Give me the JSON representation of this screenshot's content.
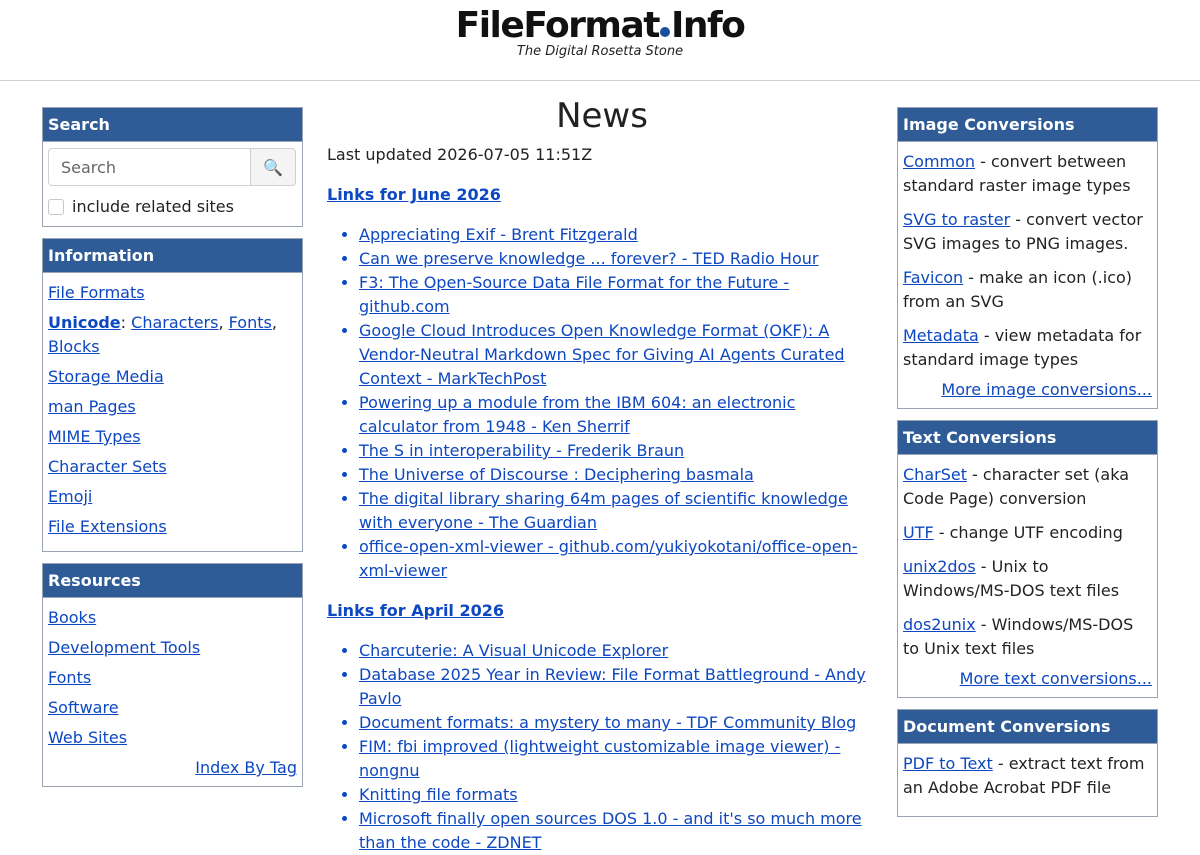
{
  "header": {
    "logo_part1": "FileFormat",
    "logo_part2": "Info",
    "tagline": "The Digital Rosetta Stone"
  },
  "search": {
    "title": "Search",
    "placeholder": "Search",
    "button_icon": "search-icon",
    "related_label": "include related sites"
  },
  "information": {
    "title": "Information",
    "file_formats": "File Formats",
    "unicode": "Unicode",
    "unicode_sep": ":",
    "characters": "Characters",
    "fonts": "Fonts",
    "blocks": "Blocks",
    "storage_media": "Storage Media",
    "man_pages": "man Pages",
    "mime_types": "MIME Types",
    "character_sets": "Character Sets",
    "emoji": "Emoji",
    "file_extensions": "File Extensions"
  },
  "resources": {
    "title": "Resources",
    "items": [
      "Books",
      "Development Tools",
      "Fonts",
      "Software",
      "Web Sites"
    ],
    "index_by_tag": "Index By Tag"
  },
  "main": {
    "title": "News",
    "updated": "Last updated 2026-07-05 11:51Z",
    "sections": [
      {
        "heading": "Links for June 2026",
        "links": [
          "Appreciating Exif - Brent Fitzgerald",
          "Can we preserve knowledge ... forever? - TED Radio Hour",
          "F3: The Open-Source Data File Format for the Future - github.com",
          "Google Cloud Introduces Open Knowledge Format (OKF): A Vendor-Neutral Markdown Spec for Giving AI Agents Curated Context - MarkTechPost",
          "Powering up a module from the IBM 604: an electronic calculator from 1948 - Ken Sherrif",
          "The S in interoperability - Frederik Braun",
          "The Universe of Discourse : Deciphering basmala",
          "The digital library sharing 64m pages of scientific knowledge with everyone - The Guardian",
          "office-open-xml-viewer - github.com/yukiyokotani/office-open-xml-viewer"
        ]
      },
      {
        "heading": "Links for April 2026",
        "links": [
          "Charcuterie: A Visual Unicode Explorer",
          "Database 2025 Year in Review: File Format Battleground - Andy Pavlo",
          "Document formats: a mystery to many - TDF Community Blog",
          "FIM: fbi improved (lightweight customizable image viewer) - nongnu",
          "Knitting file formats",
          "Microsoft finally open sources DOS 1.0 - and it's so much more than the code - ZDNET"
        ]
      }
    ]
  },
  "image_conversions": {
    "title": "Image Conversions",
    "items": [
      {
        "link": "Common",
        "desc": " - convert between standard raster image types"
      },
      {
        "link": "SVG to raster",
        "desc": " - convert vector SVG images to PNG images."
      },
      {
        "link": "Favicon",
        "desc": " - make an icon (.ico) from an SVG"
      },
      {
        "link": "Metadata",
        "desc": " - view metadata for standard image types"
      }
    ],
    "more": "More image conversions..."
  },
  "text_conversions": {
    "title": "Text Conversions",
    "items": [
      {
        "link": "CharSet",
        "desc": " - character set (aka Code Page) conversion"
      },
      {
        "link": "UTF",
        "desc": " - change UTF encoding"
      },
      {
        "link": "unix2dos",
        "desc": " - Unix to Windows/MS-DOS text files"
      },
      {
        "link": "dos2unix",
        "desc": " - Windows/MS-DOS to Unix text files"
      }
    ],
    "more": "More text conversions..."
  },
  "document_conversions": {
    "title": "Document Conversions",
    "items": [
      {
        "link": "PDF to Text",
        "desc": " - extract text from an Adobe Acrobat PDF file"
      }
    ]
  }
}
